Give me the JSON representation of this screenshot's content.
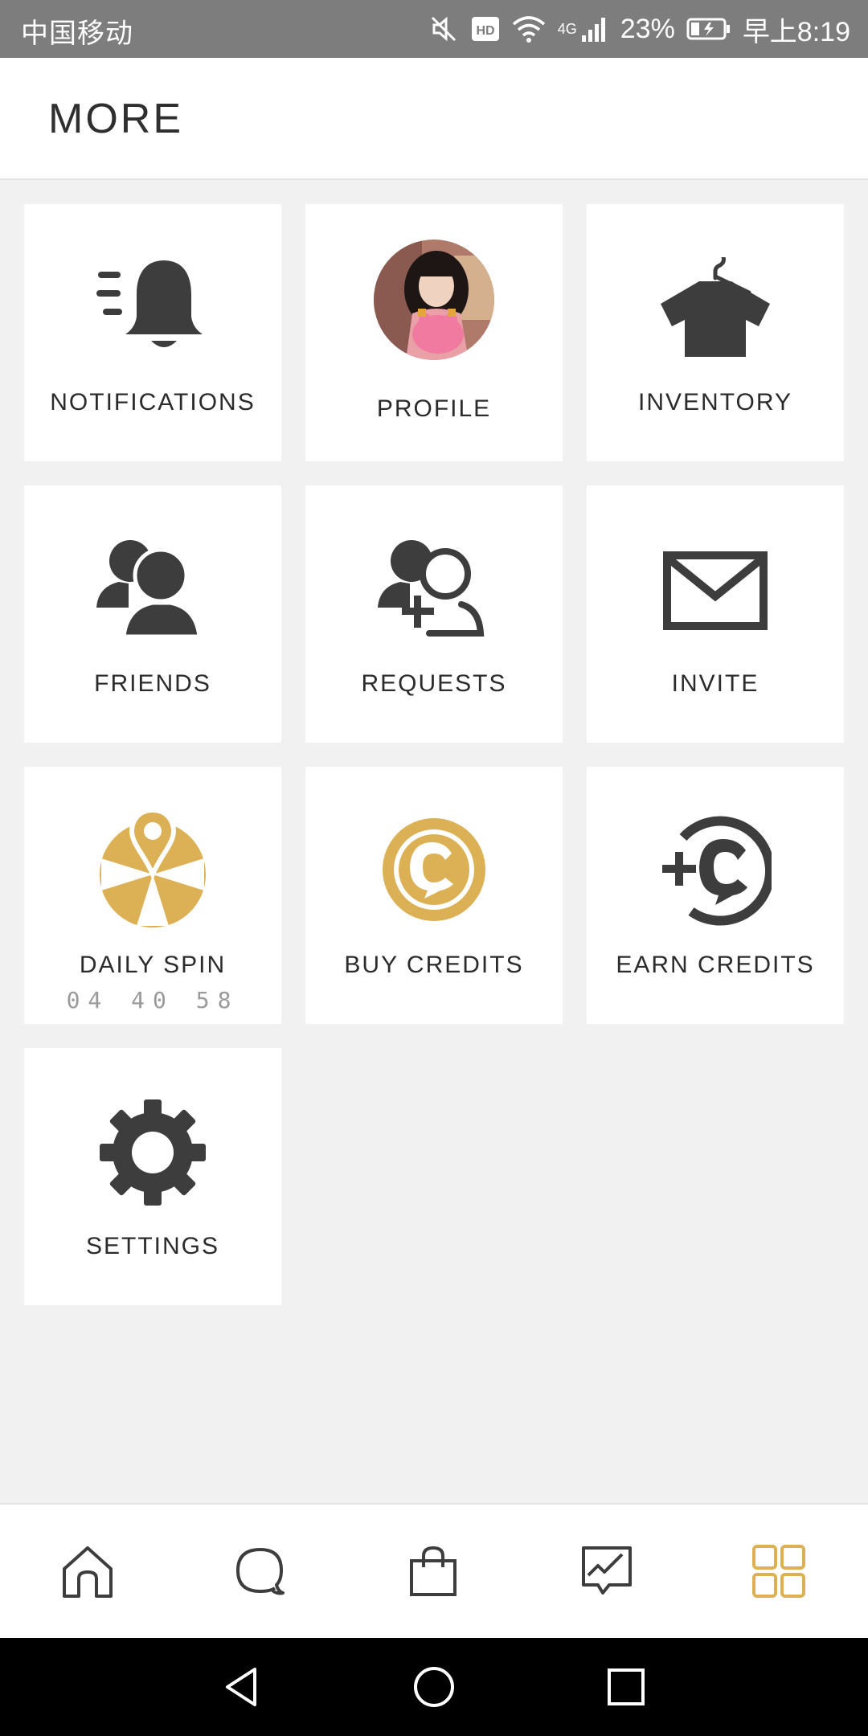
{
  "status_bar": {
    "carrier": "中国移动",
    "network": "4G",
    "battery": "23%",
    "time": "早上8:19"
  },
  "header": {
    "title": "MORE"
  },
  "tiles": [
    {
      "label": "NOTIFICATIONS",
      "icon": "bell-icon"
    },
    {
      "label": "PROFILE",
      "icon": "avatar"
    },
    {
      "label": "INVENTORY",
      "icon": "shirt-hanger-icon"
    },
    {
      "label": "FRIENDS",
      "icon": "friends-icon"
    },
    {
      "label": "REQUESTS",
      "icon": "add-friend-icon"
    },
    {
      "label": "INVITE",
      "icon": "envelope-icon"
    },
    {
      "label": "DAILY SPIN",
      "icon": "spin-wheel-icon",
      "timer": "04 40 58"
    },
    {
      "label": "BUY CREDITS",
      "icon": "credit-coin-icon"
    },
    {
      "label": "EARN CREDITS",
      "icon": "earn-credits-icon"
    },
    {
      "label": "SETTINGS",
      "icon": "gear-icon"
    }
  ],
  "bottom_nav": [
    {
      "name": "home",
      "icon": "home-icon",
      "active": false
    },
    {
      "name": "chat",
      "icon": "chat-icon",
      "active": false
    },
    {
      "name": "shop",
      "icon": "shopping-bag-icon",
      "active": false
    },
    {
      "name": "activity",
      "icon": "activity-chat-icon",
      "active": false
    },
    {
      "name": "more",
      "icon": "grid-icon",
      "active": true
    }
  ],
  "colors": {
    "icon_dark": "#3d3d3d",
    "accent_gold": "#dcb155",
    "background": "#f1f1f1",
    "status_bar": "#7d7d7d"
  }
}
